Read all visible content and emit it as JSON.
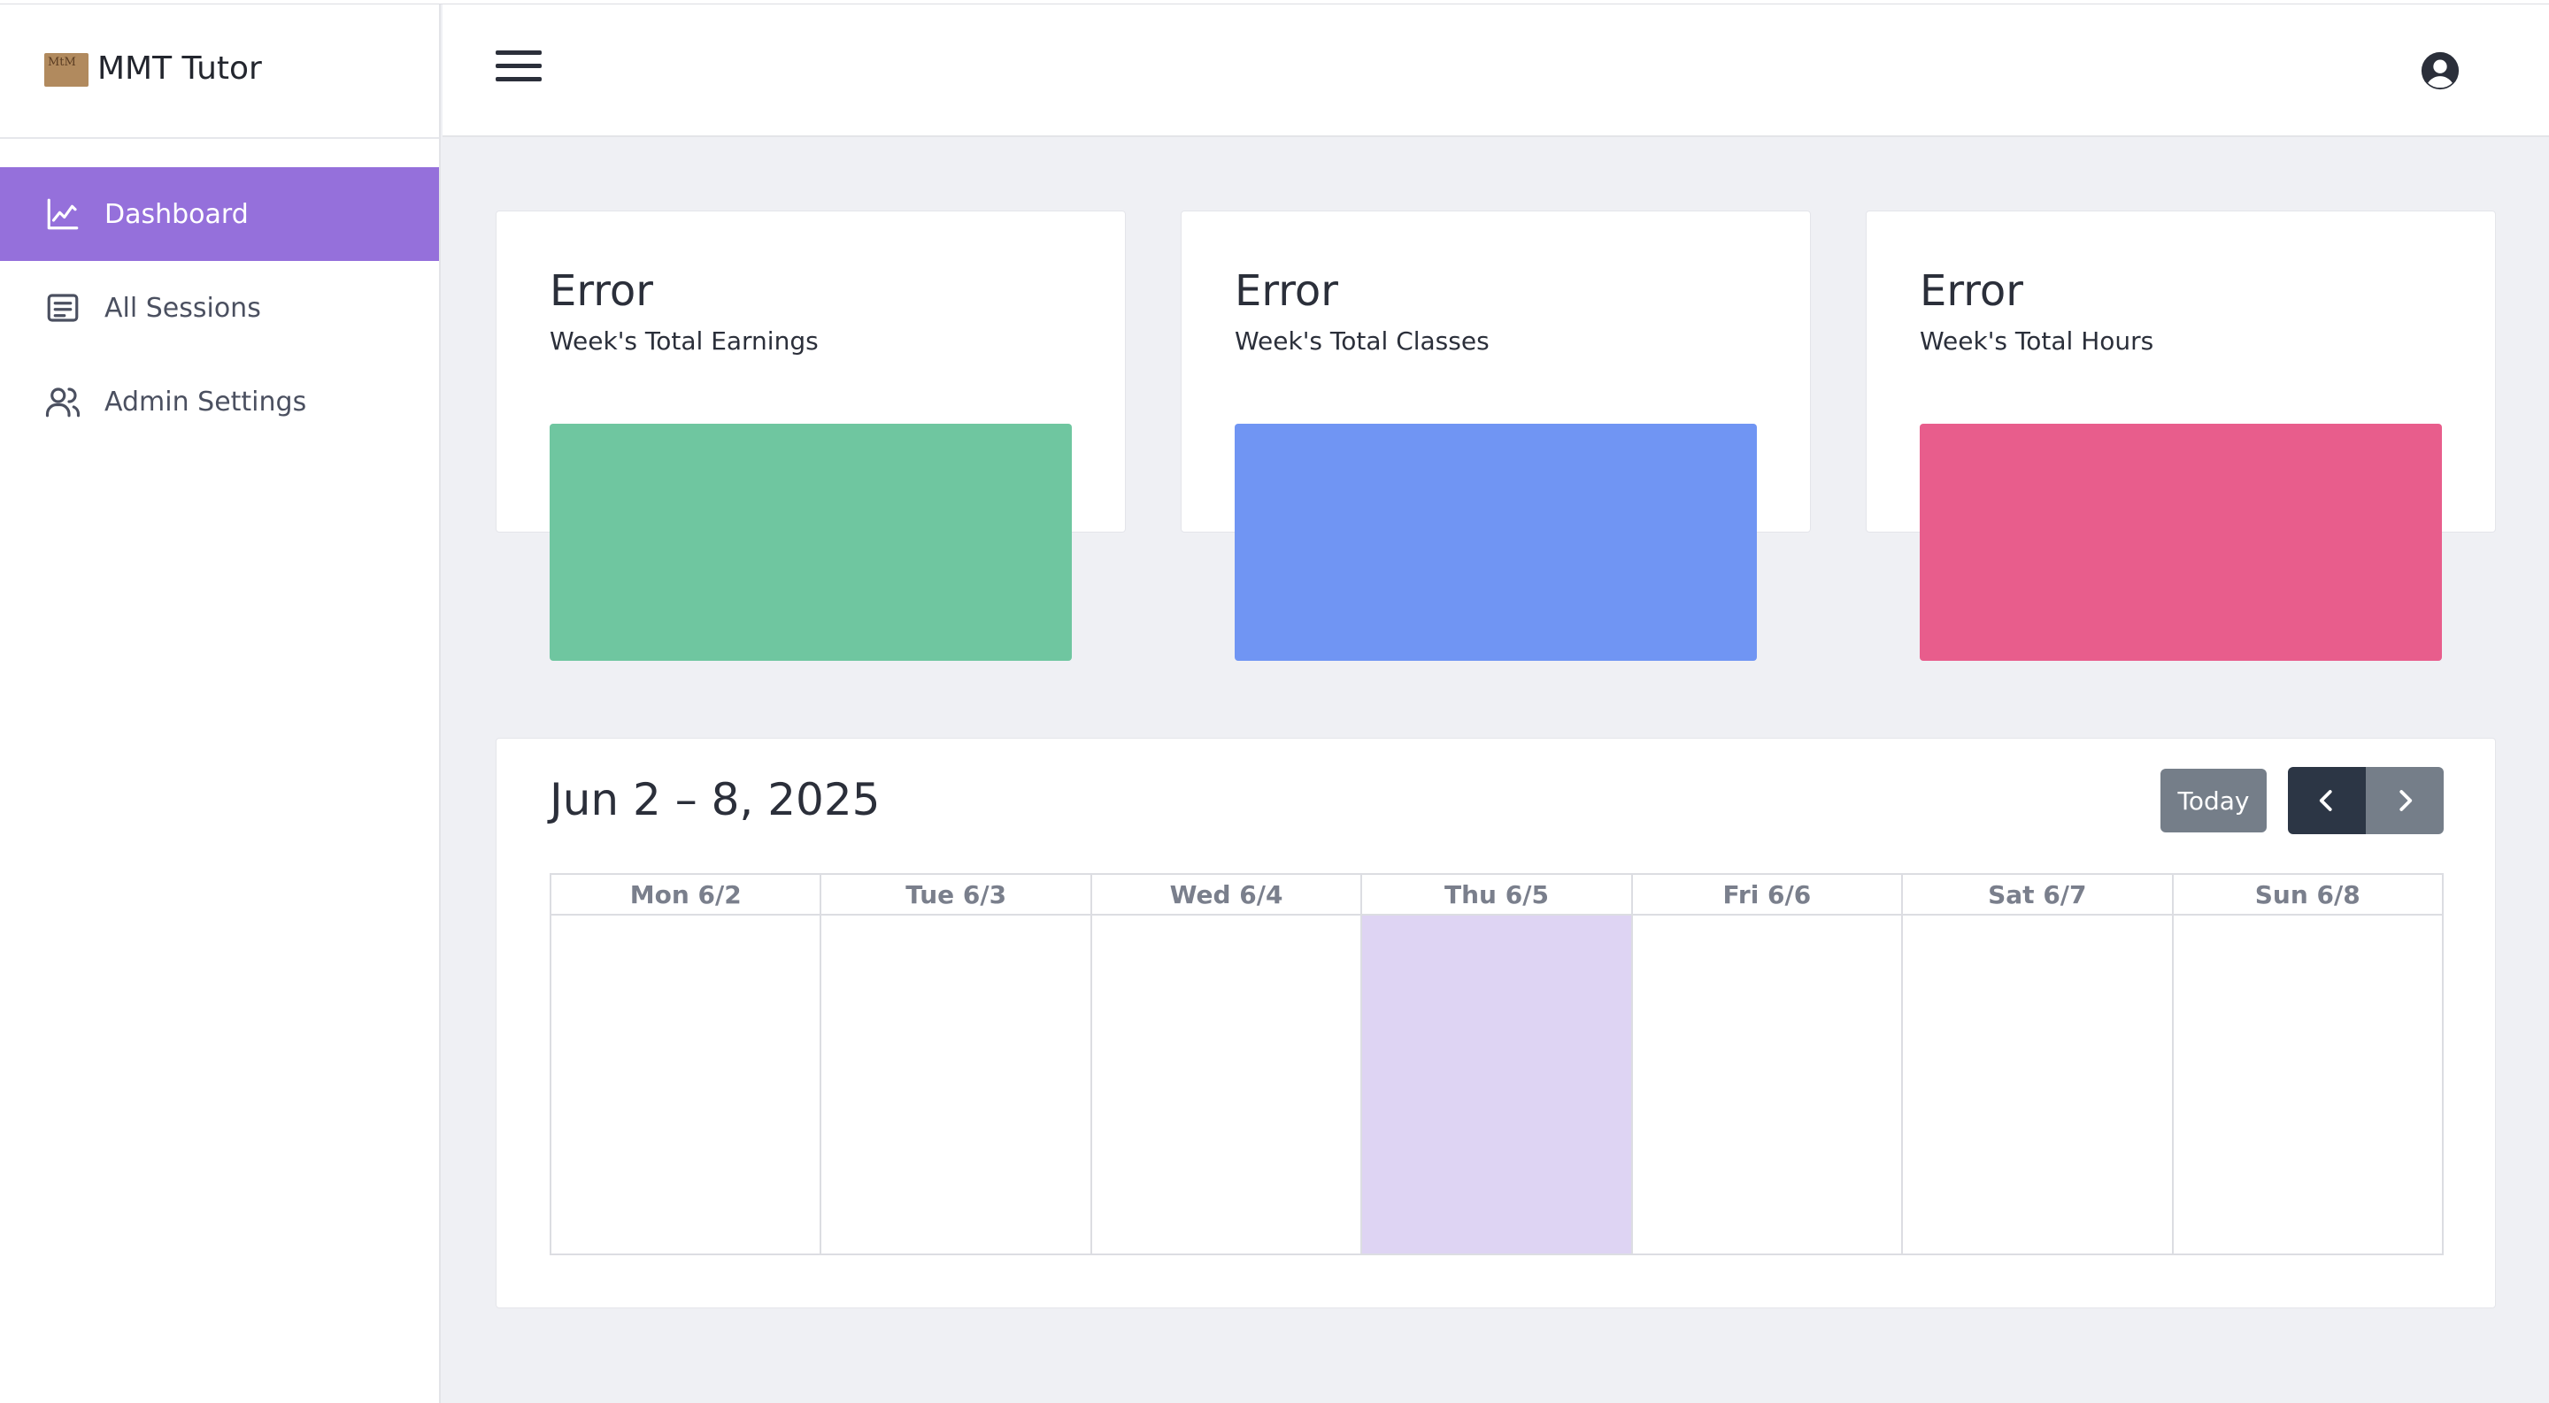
{
  "brand": {
    "name": "MMT Tutor",
    "logo_text": "MtM"
  },
  "sidebar": {
    "items": [
      {
        "label": "Dashboard",
        "icon": "line-chart-icon",
        "active": true
      },
      {
        "label": "All Sessions",
        "icon": "list-icon",
        "active": false
      },
      {
        "label": "Admin Settings",
        "icon": "users-icon",
        "active": false
      }
    ]
  },
  "header": {
    "menu_icon": "hamburger-icon",
    "profile_icon": "user-circle-icon"
  },
  "stats": [
    {
      "value": "Error",
      "label": "Week's Total Earnings",
      "color": "#6fc6a0"
    },
    {
      "value": "Error",
      "label": "Week's Total Classes",
      "color": "#7095f3"
    },
    {
      "value": "Error",
      "label": "Week's Total Hours",
      "color": "#e85d8c"
    }
  ],
  "calendar": {
    "title": "Jun 2 – 8, 2025",
    "today_label": "Today",
    "prev_icon": "chevron-left-icon",
    "next_icon": "chevron-right-icon",
    "days": [
      "Mon 6/2",
      "Tue 6/3",
      "Wed 6/4",
      "Thu 6/5",
      "Fri 6/6",
      "Sat 6/7",
      "Sun 6/8"
    ],
    "today_index": 3,
    "today_color": "#ded4f3"
  },
  "colors": {
    "accent": "#9570db",
    "dark_button": "#2c3645",
    "gray_button": "#757e89"
  }
}
